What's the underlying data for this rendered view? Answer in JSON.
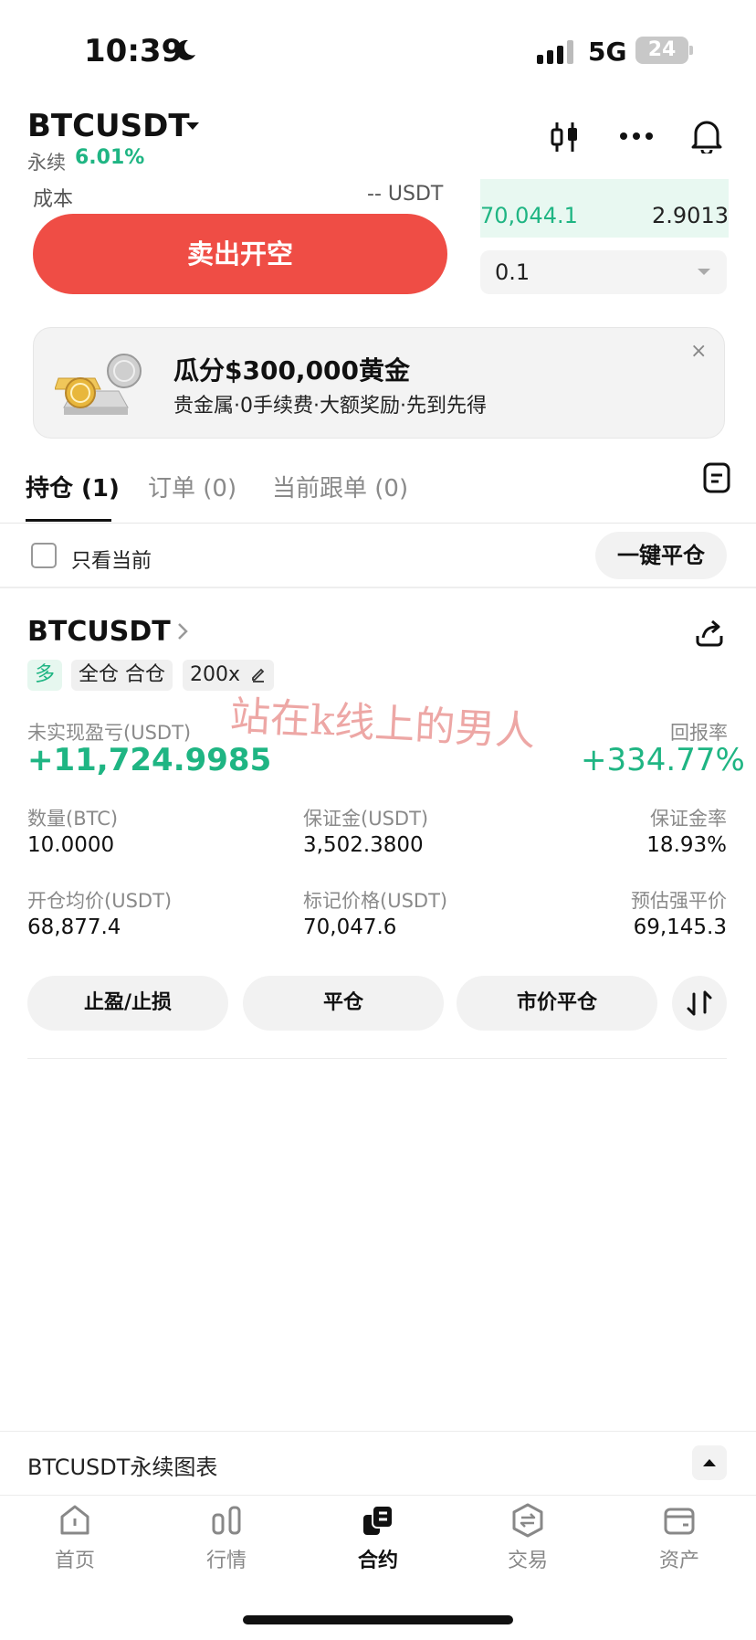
{
  "status_bar": {
    "time": "10:39",
    "network": "5G",
    "battery": "24"
  },
  "header": {
    "pair": "BTCUSDT",
    "perp_label": "永续",
    "change_pct": "6.01%"
  },
  "order_panel": {
    "cost_label": "成本",
    "cost_value": "-- USDT",
    "sell_button": "卖出开空",
    "book_price": "70,044.1",
    "book_qty": "2.9013",
    "qty_value": "0.1"
  },
  "promo": {
    "title": "瓜分$300,000黄金",
    "subtitle": "贵金属·0手续费·大额奖励·先到先得",
    "close": "×"
  },
  "tabs": [
    {
      "label": "持仓 (1)"
    },
    {
      "label": "订单 (0)"
    },
    {
      "label": "当前跟单 (0)"
    }
  ],
  "filter": {
    "only_current": "只看当前",
    "close_all": "一键平仓"
  },
  "position": {
    "pair": "BTCUSDT",
    "side": "多",
    "margin_mode": "全仓 合仓",
    "leverage": "200x",
    "watermark": "站在k线上的男人",
    "pnl_label": "未实现盈亏(USDT)",
    "pnl_value": "+11,724.9985",
    "roe_label": "回报率",
    "roe_value": "+334.77%",
    "fields": [
      {
        "label": "数量(BTC)",
        "value": "10.0000"
      },
      {
        "label": "保证金(USDT)",
        "value": "3,502.3800"
      },
      {
        "label": "保证金率",
        "value": "18.93%"
      },
      {
        "label": "开仓均价(USDT)",
        "value": "68,877.4"
      },
      {
        "label": "标记价格(USDT)",
        "value": "70,047.6"
      },
      {
        "label": "预估强平价",
        "value": "69,145.3"
      }
    ],
    "actions": [
      "止盈/止损",
      "平仓",
      "市价平仓"
    ]
  },
  "chart_bar": {
    "label": "BTCUSDT永续图表"
  },
  "nav": [
    {
      "label": "首页",
      "icon": "home-icon"
    },
    {
      "label": "行情",
      "icon": "market-icon"
    },
    {
      "label": "合约",
      "icon": "futures-icon"
    },
    {
      "label": "交易",
      "icon": "trade-icon"
    },
    {
      "label": "资产",
      "icon": "wallet-icon"
    }
  ],
  "colors": {
    "green": "#1fb583",
    "red": "#ef4d45",
    "text": "#111111",
    "muted": "#8a8a8a"
  }
}
